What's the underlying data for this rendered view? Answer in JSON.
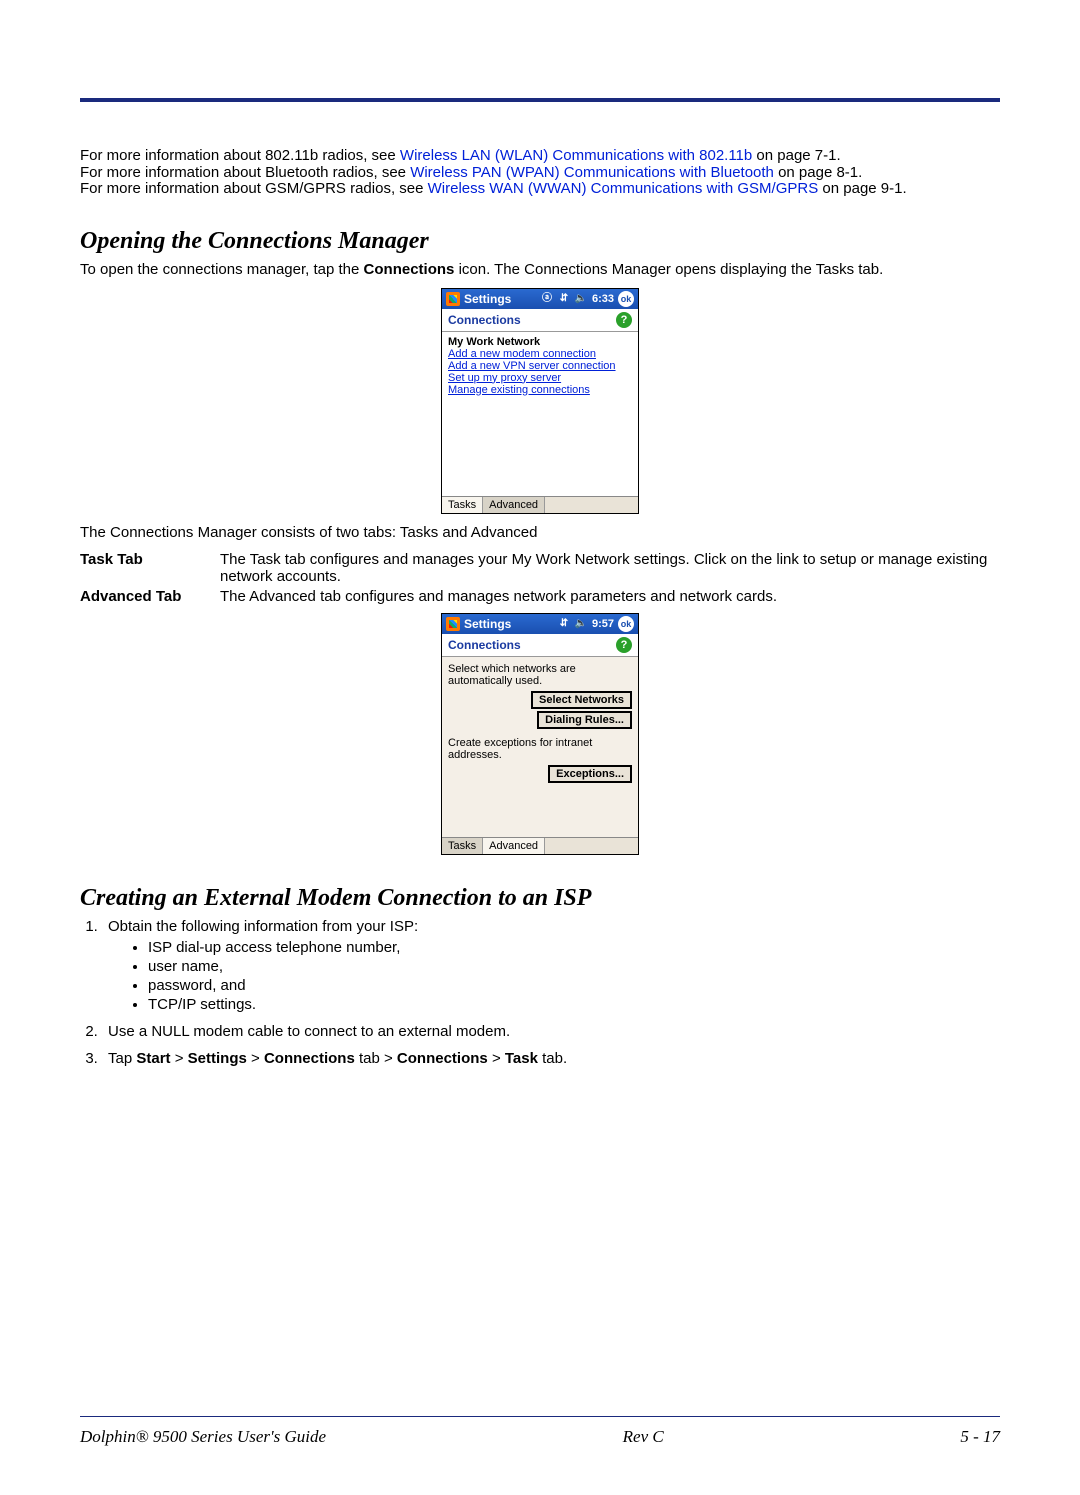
{
  "intro": {
    "l1a": "For more information about 802.11b radios, see ",
    "l1l": "Wireless LAN (WLAN) Communications with 802.11b",
    "l1b": " on page 7-1.",
    "l2a": "For more information about Bluetooth radios, see ",
    "l2l": "Wireless PAN (WPAN) Communications with Bluetooth",
    "l2b": " on page 8-1.",
    "l3a": "For more information about GSM/GPRS radios, see ",
    "l3l": "Wireless WAN (WWAN) Communications with GSM/GPRS",
    "l3b": " on page 9-1."
  },
  "sec1_title": "Opening the Connections Manager",
  "sec1_p_a": "To open the connections manager, tap the ",
  "sec1_p_b": "Connections",
  "sec1_p_c": " icon. The Connections Manager opens displaying the Tasks tab.",
  "dev1": {
    "title": "Settings",
    "time": "6:33",
    "subtitle": "Connections",
    "heading": "My Work Network",
    "link1": "Add a new modem connection",
    "link2": "Add a new VPN server connection",
    "link3": "Set up my proxy server",
    "link4": "Manage existing connections",
    "tab1": "Tasks",
    "tab2": "Advanced"
  },
  "sec1_after": "The Connections Manager consists of two tabs: Tasks and Advanced",
  "defs": {
    "task_lab": "Task Tab",
    "task_val": "The Task tab configures and manages your My Work Network settings. Click on the link to setup or manage existing network accounts.",
    "adv_lab": "Advanced Tab",
    "adv_val": "The Advanced tab configures and manages network parameters and network cards."
  },
  "dev2": {
    "title": "Settings",
    "time": "9:57",
    "subtitle": "Connections",
    "lbl1": "Select which networks are automatically used.",
    "btn1": "Select Networks",
    "btn2": "Dialing Rules...",
    "lbl2": "Create exceptions for intranet addresses.",
    "btn3": "Exceptions...",
    "tab1": "Tasks",
    "tab2": "Advanced"
  },
  "sec2_title": "Creating an External Modem Connection to an ISP",
  "steps": {
    "s1": "Obtain the following information from your ISP:",
    "s1b1": "ISP dial-up access telephone number,",
    "s1b2": "user name,",
    "s1b3": "password, and",
    "s1b4": "TCP/IP settings.",
    "s2": "Use a NULL modem cable to connect to an external modem.",
    "s3a": "Tap ",
    "s3b": "Start",
    "s3c": " > ",
    "s3d": "Settings",
    "s3e": " > ",
    "s3f": "Connections",
    "s3g": " tab > ",
    "s3h": "Connections",
    "s3i": " > ",
    "s3j": "Task",
    "s3k": " tab."
  },
  "footer": {
    "left": "Dolphin® 9500 Series User's Guide",
    "mid": "Rev C",
    "right": "5 - 17"
  }
}
